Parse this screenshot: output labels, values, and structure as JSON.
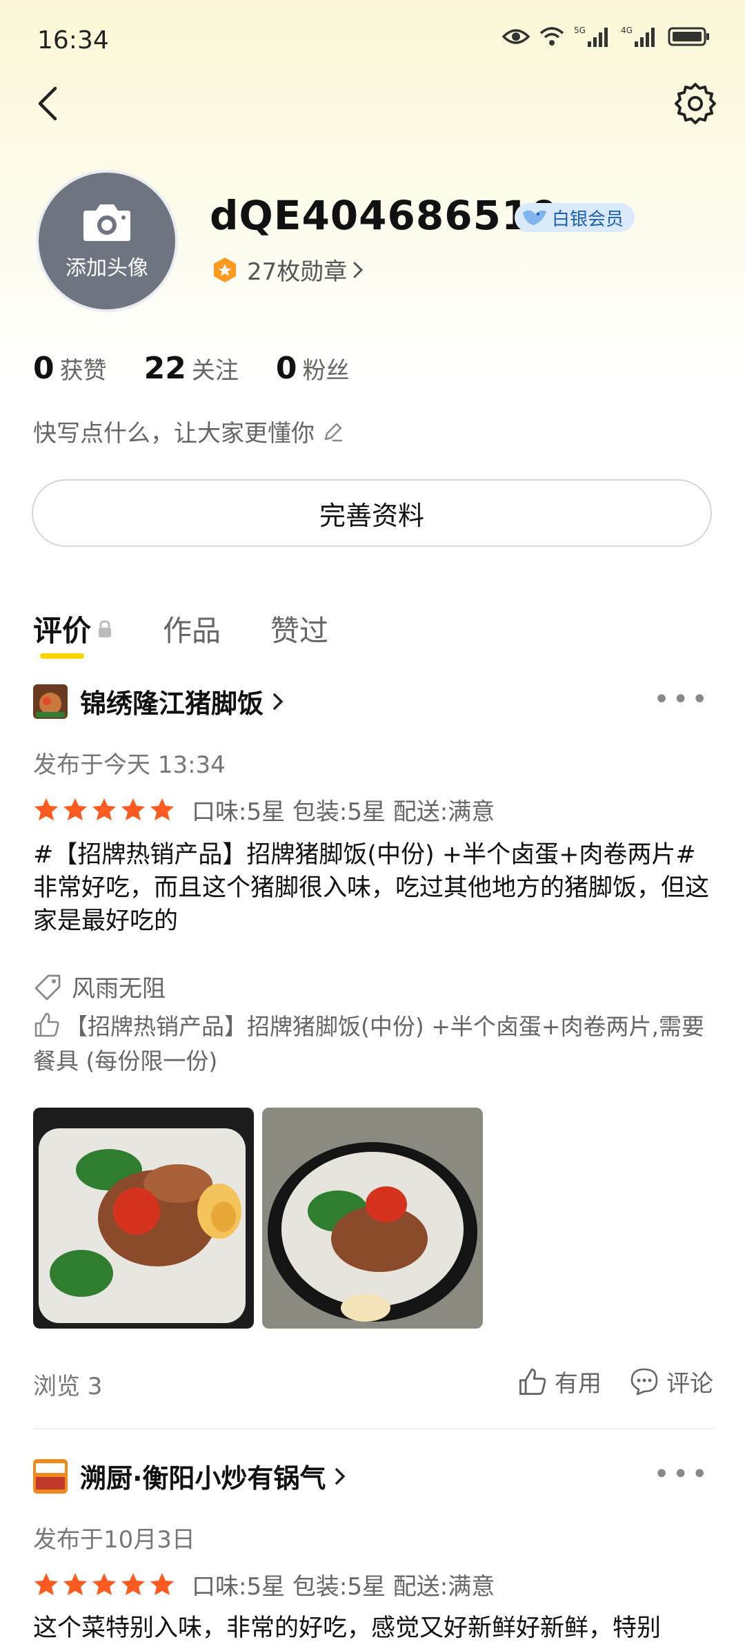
{
  "status_bar": {
    "time": "16:34",
    "network_1": "5G",
    "network_2": "4G"
  },
  "profile": {
    "avatar_label": "添加头像",
    "username": "dQE404686510",
    "member_badge": "白银会员",
    "medals": "27枚勋章",
    "stats": [
      {
        "num": "0",
        "label": "获赞"
      },
      {
        "num": "22",
        "label": "关注"
      },
      {
        "num": "0",
        "label": "粉丝"
      }
    ],
    "bio_placeholder": "快写点什么，让大家更懂你",
    "edit_button": "完善资料"
  },
  "tabs": [
    {
      "label": "评价",
      "active": true
    },
    {
      "label": "作品",
      "active": false
    },
    {
      "label": "赞过",
      "active": false
    }
  ],
  "reviews": [
    {
      "shop": "锦绣隆江猪脚饭",
      "date": "发布于今天 13:34",
      "stars": 5,
      "ratings": "口味:5星 包装:5星 配送:满意",
      "text": "#【招牌热销产品】招牌猪脚饭(中份) +半个卤蛋+肉卷两片# 非常好吃，而且这个猪脚很入味，吃过其他地方的猪脚饭，但这家是最好吃的",
      "tag": "风雨无阻",
      "dish": "【招牌热销产品】招牌猪脚饭(中份) +半个卤蛋+肉卷两片,需要餐具 (每份限一份)",
      "views": "浏览 3",
      "useful_label": "有用",
      "comment_label": "评论"
    },
    {
      "shop": "溯厨·衡阳小炒有锅气",
      "date": "发布于10月3日",
      "stars": 5,
      "ratings": "口味:5星 包装:5星 配送:满意",
      "text": "这个菜特别入味，非常的好吃，感觉又好新鲜好新鲜，特别"
    }
  ],
  "colors": {
    "accent_yellow": "#ffd400",
    "star_orange": "#ff5a1f",
    "badge_blue": "#dbeafb"
  }
}
